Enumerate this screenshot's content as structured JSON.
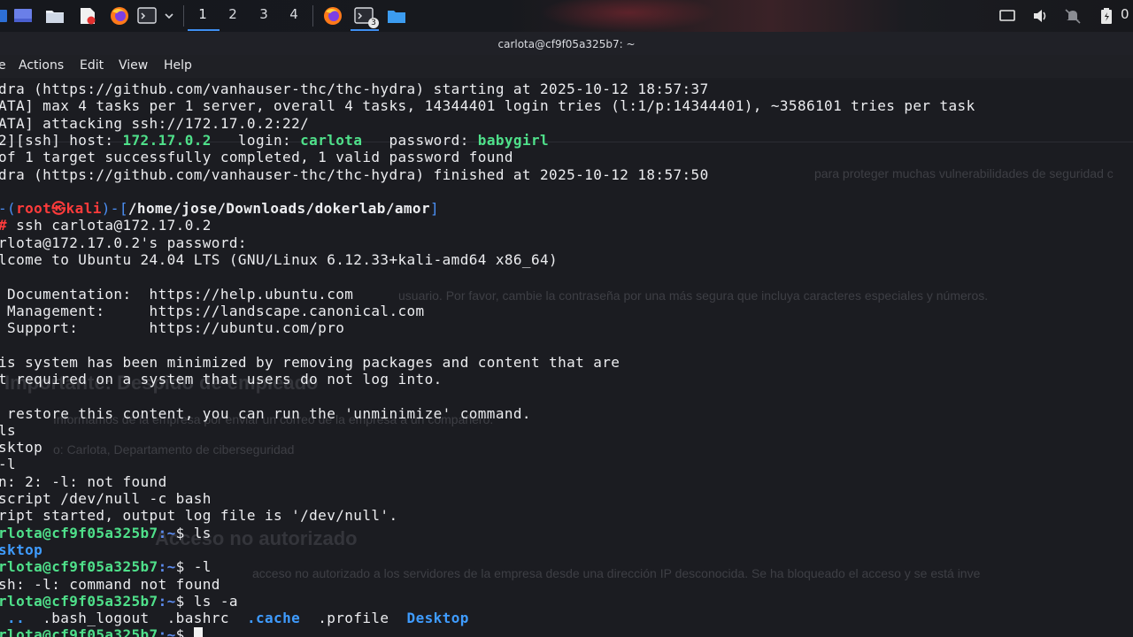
{
  "taskbar": {
    "workspaces": [
      "1",
      "2",
      "3",
      "4"
    ],
    "active_workspace": "1",
    "terminal_badge": "3",
    "clock": "0"
  },
  "terminal": {
    "title": "carlota@cf9f05a325b7: ~",
    "menu": {
      "actions": "Actions",
      "edit": "Edit",
      "view": "View",
      "help": "Help"
    },
    "menu_partial": "e",
    "lines": {
      "l1": "dra (https://github.com/vanhauser-thc/thc-hydra) starting at 2025-10-12 18:57:37",
      "l2": "ATA] max 4 tasks per 1 server, overall 4 tasks, 14344401 login tries (l:1/p:14344401), ~3586101 tries per task",
      "l3": "ATA] attacking ssh://172.17.0.2:22/",
      "l4_a": "2][ssh] host: ",
      "l4_host": "172.17.0.2",
      "l4_b": "   login: ",
      "l4_login": "carlota",
      "l4_c": "   password: ",
      "l4_pass": "babygirl",
      "l5": "of 1 target successfully completed, 1 valid password found",
      "l6": "dra (https://github.com/vanhauser-thc/thc-hydra) finished at 2025-10-12 18:57:50",
      "l8_a": "-(",
      "l8_user": "root",
      "l8_at": "㉿",
      "l8_host": "kali",
      "l8_b": ")-[",
      "l8_path": "/home/jose/Downloads/dokerlab/amor",
      "l8_c": "]",
      "l9_sym": "#",
      "l9_cmd": " ssh carlota@172.17.0.2",
      "l10": "rlota@172.17.0.2's password:",
      "l11": "lcome to Ubuntu 24.04 LTS (GNU/Linux 6.12.33+kali-amd64 x86_64)",
      "l13": " Documentation:  https://help.ubuntu.com",
      "l14": " Management:     https://landscape.canonical.com",
      "l15": " Support:        https://ubuntu.com/pro",
      "l17": "is system has been minimized by removing packages and content that are",
      "l18": "t required on a system that users do not log into.",
      "l20": " restore this content, you can run the 'unminimize' command.",
      "l21": "ls",
      "l22": "sktop",
      "l23": "-l",
      "l24": "n: 2: -l: not found",
      "l25": "script /dev/null -c bash",
      "l26": "ript started, output log file is '/dev/null'.",
      "p_user": "rlota@cf9f05a325b7",
      "p_path": ":~",
      "p_dollar": "$ ",
      "l27_cmd": "ls",
      "l28": "sktop",
      "l29_cmd": "-l",
      "l30": "sh: -l: command not found",
      "l31_cmd": "ls -a",
      "l32_dotdot": " ..",
      "l32_mid": "  .bash_logout  .bashrc  ",
      "l32_cache": ".cache",
      "l32_profile": "  .profile  ",
      "l32_desktop": "Desktop"
    }
  },
  "background_page": {
    "heading1": "Importante: Despido de empleado",
    "heading2": "Acceso no autorizado",
    "text1": "para proteger muchas vulnerabilidades de seguridad c",
    "text2": "usuario. Por favor, cambie la contraseña por una más segura que incluya caracteres especiales y números.",
    "text3": "Informamos de la empresa por enviar un correo de la empresa a un compañero.",
    "text4": "o: Carlota, Departamento de ciberseguridad",
    "text5": "acceso no autorizado a los servidores de la empresa desde una dirección IP desconocida. Se ha bloqueado el acceso y se está inve"
  },
  "colors": {
    "terminal_bg": "#1b1c21",
    "cyan": "#3fd7f2",
    "green": "#4fe08a",
    "red": "#ff3b3b",
    "accent": "#3f8ef0"
  }
}
